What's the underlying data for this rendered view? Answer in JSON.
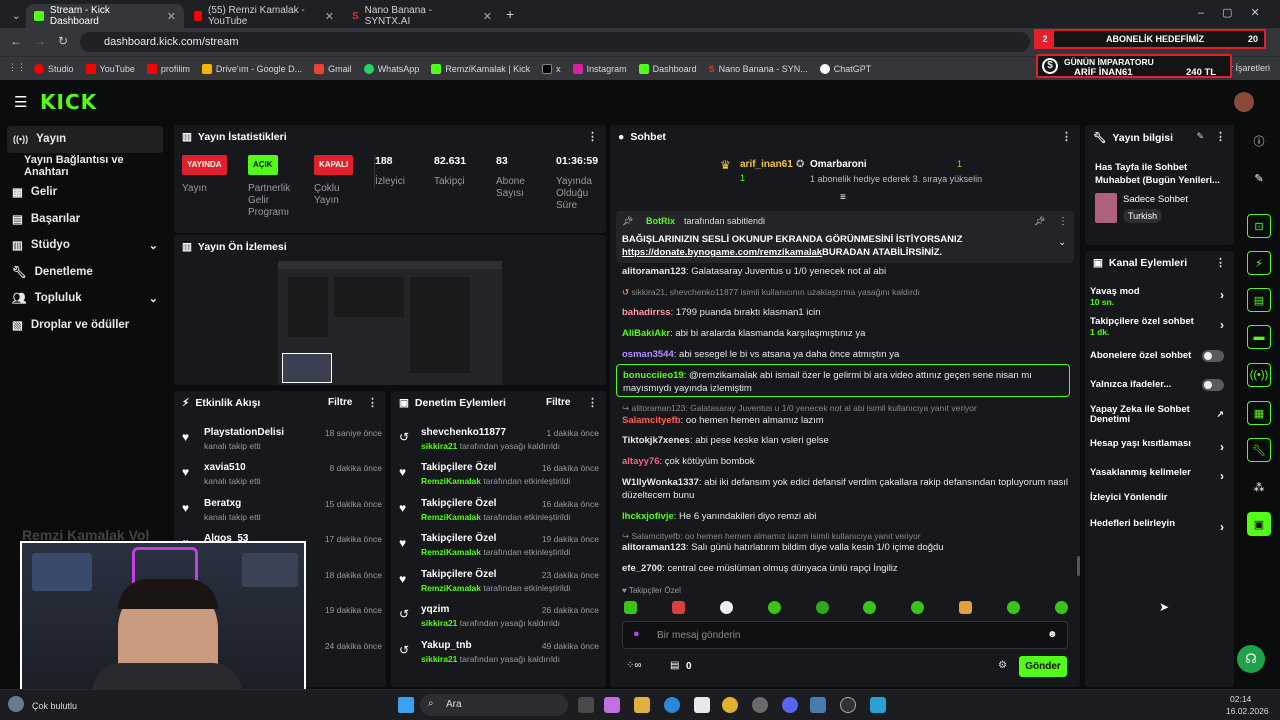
{
  "browser": {
    "tabs": [
      {
        "label": "Stream - Kick Dashboard",
        "active": true
      },
      {
        "label": "(55) Remzi Kamalak - YouTube",
        "active": false
      },
      {
        "label": "Nano Banana - SYNTX.AI",
        "active": false
      }
    ],
    "url": "dashboard.kick.com/stream",
    "bookmarks": [
      "Studio",
      "YouTube",
      "profilim",
      "Drive'ım - Google D...",
      "Gmail",
      "WhatsApp",
      "RemziKamalak | Kick",
      "x",
      "Instagram",
      "Dashboard",
      "Nano Banana - SYN...",
      "ChatGPT"
    ],
    "bookmarks_right": "Yer İşaretleri"
  },
  "overlay": {
    "goal_number": "2",
    "goal_label": "ABONELİK HEDEFİMİZ",
    "goal_target": "20",
    "emperor_title": "GÜNÜN İMPARATORU",
    "emperor_name": "ARİF İNAN61",
    "emperor_amount": "240 TL"
  },
  "sidebar": {
    "items": [
      {
        "label": "Yayın",
        "icon": "broadcast-icon"
      },
      {
        "label": "Yayın Bağlantısı ve Anahtarı",
        "icon": ""
      },
      {
        "label": "Gelir",
        "icon": "revenue-icon"
      },
      {
        "label": "Başarılar",
        "icon": "achievements-icon"
      },
      {
        "label": "Stüdyo",
        "icon": "studio-icon"
      },
      {
        "label": "Denetleme",
        "icon": "wrench-icon"
      },
      {
        "label": "Topluluk",
        "icon": "community-icon"
      },
      {
        "label": "Droplar ve ödüller",
        "icon": "drops-icon"
      }
    ]
  },
  "stats": {
    "title": "Yayın İstatistikleri",
    "items": [
      {
        "badge": "YAYINDA",
        "label": "Yayın"
      },
      {
        "badge": "AÇIK",
        "label": "Partnerlik Gelir Programı"
      },
      {
        "badge": "KAPALI",
        "label": "Çoklu Yayın"
      },
      {
        "value": "188",
        "label": "İzleyici"
      },
      {
        "value": "82.631",
        "label": "Takipçi"
      },
      {
        "value": "83",
        "label": "Abone Sayısı"
      },
      {
        "value": "01:36:59",
        "label": "Yayında Olduğu Süre"
      }
    ]
  },
  "preview": {
    "title": "Yayın Ön İzlemesi"
  },
  "activity": {
    "title": "Etkinlik Akışı",
    "filter": "Filtre",
    "items": [
      {
        "name": "PlaystationDelisi",
        "sub": "kanalı takip etti",
        "time": "18 saniye önce"
      },
      {
        "name": "xavia510",
        "sub": "kanalı takip etti",
        "time": "8 dakika önce"
      },
      {
        "name": "Beratxg",
        "sub": "kanalı takip etti",
        "time": "15 dakika önce"
      },
      {
        "name": "Algos_53",
        "sub": "",
        "time": "17 dakika önce"
      },
      {
        "name": "",
        "sub": "",
        "time": "18 dakika önce"
      },
      {
        "name": "",
        "sub": "",
        "time": "19 dakika önce"
      },
      {
        "name": "",
        "sub": "",
        "time": "24 dakika önce"
      }
    ]
  },
  "moderation": {
    "title": "Denetim Eylemleri",
    "filter": "Filtre",
    "items": [
      {
        "name": "shevchenko11877",
        "by": "sikkira21",
        "action": "tarafından yasağı kaldırıldı",
        "time": "1 dakika önce",
        "icon": "undo-icon"
      },
      {
        "name": "Takipçilere Özel",
        "by": "RemziKamalak",
        "action": "tarafından etkinleştirildi",
        "time": "16 dakika önce",
        "icon": "heart-icon"
      },
      {
        "name": "Takipçilere Özel",
        "by": "RemziKamalak",
        "action": "tarafından etkinleştirildi",
        "time": "16 dakika önce",
        "icon": "heart-icon"
      },
      {
        "name": "Takipçilere Özel",
        "by": "RemziKamalak",
        "action": "tarafından etkinleştirildi",
        "time": "19 dakika önce",
        "icon": "heart-icon"
      },
      {
        "name": "Takipçilere Özel",
        "by": "RemziKamalak",
        "action": "tarafından etkinleştirildi",
        "time": "23 dakika önce",
        "icon": "heart-icon"
      },
      {
        "name": "yqzim",
        "by": "sikkira21",
        "action": "tarafından yasağı kaldırıldı",
        "time": "26 dakika önce",
        "icon": "undo-icon"
      },
      {
        "name": "Yakup_tnb",
        "by": "sikkira21",
        "action": "tarafından yasağı kaldırıldı",
        "time": "49 dakika önce",
        "icon": "undo-icon"
      }
    ]
  },
  "chat": {
    "title": "Sohbet",
    "top_gifter": "arif_inan61",
    "top_gifter_count": "1",
    "second_user": "Omarbaroni",
    "second_count": "1",
    "second_sub": "1 abonelik hediye ederek 3. sıraya yükselin",
    "pinned_by": "BotRix",
    "pinned_by_suffix": "tarafından sabitlendi",
    "pinned_line1": "BAĞIŞLARINIZIN SESLİ OKUNUP EKRANDA GÖRÜNMESİNİ İSTİYORSANIZ",
    "pinned_link": "https://donate.bynogame.com/remzikamalak",
    "pinned_line2": "BURADAN ATABİLİRSİNİZ.",
    "messages": [
      {
        "user": "alitoraman123",
        "color": "#e8e8e8",
        "text": "Galatasaray Juventus u 1/0 yenecek not al abi"
      },
      {
        "user": "",
        "color": "#8a8a8a",
        "text": "sikkira21, shevchenko11877 isimli kullanıcının uzaklaştırma yasağını kaldırdı",
        "system": true
      },
      {
        "user": "bahadirrss",
        "color": "#ff9aa0",
        "text": "1799 puanda bıraktı klasman1 icin"
      },
      {
        "user": "AliBakiAkr",
        "color": "#53fc18",
        "text": "abi bi aralarda klasmanda karşılaşmıştınız ya"
      },
      {
        "user": "osman3544",
        "color": "#b48cff",
        "text": "abi sesegel le bi vs atsana ya daha önce atmıştın ya"
      },
      {
        "user": "bonucciieo19",
        "color": "#53fc18",
        "text": "@remzikamalak abi ismail özer le gelirmi bi ara video attınız geçen sene nisan mı mayısmıydı yayında izlemiştim"
      },
      {
        "user": "",
        "color": "#8a8a8a",
        "text": "alitoraman123: Galatasaray Juventus u 1/0 yenecek not al abi isimli kullanıcıya yanıt veriyor",
        "system": true
      },
      {
        "user": "Salamcityefb",
        "color": "#ff5d5d",
        "text": "oo hemen hemen almamız lazım"
      },
      {
        "user": "Tiktokjk7xenes",
        "color": "#e8e8e8",
        "text": "abi pese keske klan vsleri gelse"
      },
      {
        "user": "altayy76",
        "color": "#ff5d8a",
        "text": "çok kötüyüm bombok"
      },
      {
        "user": "W1llyWonka1337",
        "color": "#e8e8e8",
        "text": "abi iki defansım yok edici defansif verdim çakallara rakip defansından topluyorum nasıl düzeltecem bunu"
      },
      {
        "user": "lhckxjofivje",
        "color": "#53fc18",
        "text": "He 6 yanındakileri diyo remzi abi"
      },
      {
        "user": "",
        "color": "#8a8a8a",
        "text": "Salamcityefb: oo hemen hemen almamız lazım isimli kullanıcıya yanıt veriyor",
        "system": true
      },
      {
        "user": "alitoraman123",
        "color": "#e8e8e8",
        "text": "Salı günü hatırlatırım bildim diye valla kesin 1/0 içime doğdu"
      },
      {
        "user": "efe_2700",
        "color": "#e8e8e8",
        "text": "central cee müslüman olmuş dünyaca ünlü rapçi İngiliz"
      }
    ],
    "followers_only": "Takipçiler Özel",
    "input_placeholder": "Bir mesaj gönderin",
    "points": "0",
    "send": "Gönder"
  },
  "stream_info": {
    "title": "Yayın bilgisi",
    "stream_title": "Has Tayfa ile Sohbet Muhabbet (Bugün Yenileri...",
    "category": "Sadece Sohbet",
    "language": "Turkish"
  },
  "channel_actions": {
    "title": "Kanal Eylemleri",
    "items": [
      {
        "label": "Yavaş mod",
        "sub": "10 sn.",
        "type": "chevron"
      },
      {
        "label": "Takipçilere özel sohbet",
        "sub": "1 dk.",
        "type": "chevron"
      },
      {
        "label": "Abonelere özel sohbet",
        "sub": "",
        "type": "toggle"
      },
      {
        "label": "Yalnızca ifadeler...",
        "sub": "",
        "type": "toggle"
      },
      {
        "label": "Yapay Zeka ile Sohbet Denetimi",
        "sub": "",
        "type": "external"
      },
      {
        "label": "Hesap yaşı kısıtlaması",
        "sub": "",
        "type": "chevron"
      },
      {
        "label": "Yasaklanmış kelimeler",
        "sub": "",
        "type": "chevron"
      },
      {
        "label": "İzleyici Yönlendir",
        "sub": "",
        "type": "none"
      },
      {
        "label": "Hedefleri belirleyin",
        "sub": "",
        "type": "chevron"
      }
    ]
  },
  "webcam": {
    "overlay_text": "Remzi Kamalak Vol"
  },
  "taskbar": {
    "weather": "Çok bulutlu",
    "search": "Ara",
    "time": "02:14",
    "date": "16.02.2026"
  }
}
